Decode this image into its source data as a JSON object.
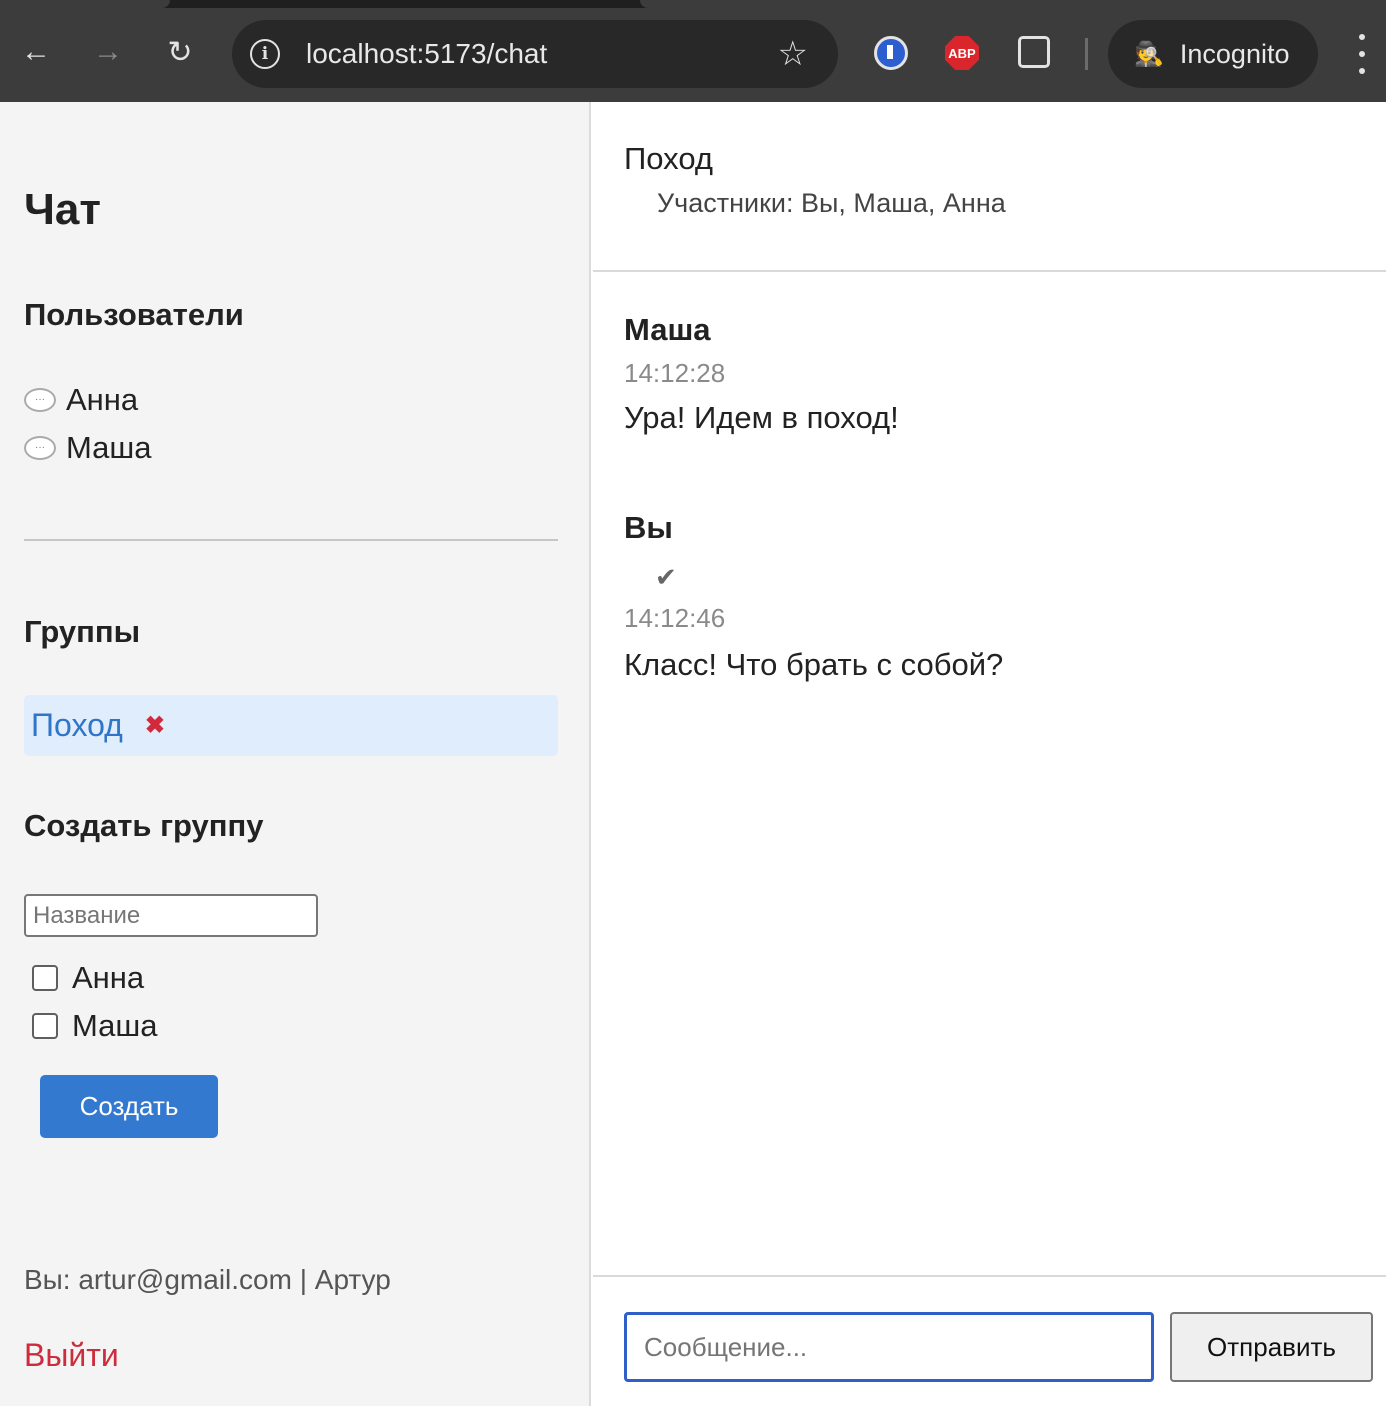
{
  "browser": {
    "url": "localhost:5173/chat",
    "incognito_label": "Incognito",
    "extensions": {
      "abp_label": "ABP"
    }
  },
  "sidebar": {
    "title": "Чат",
    "users_heading": "Пользователи",
    "users": [
      {
        "name": "Анна"
      },
      {
        "name": "Маша"
      }
    ],
    "groups_heading": "Группы",
    "groups": [
      {
        "name": "Поход",
        "delete_icon": "✖"
      }
    ],
    "create_heading": "Создать группу",
    "name_placeholder": "Название",
    "member_options": [
      {
        "name": "Анна",
        "checked": false
      },
      {
        "name": "Маша",
        "checked": false
      }
    ],
    "create_label": "Создать",
    "me": "Вы: artur@gmail.com | Артур",
    "logout_label": "Выйти"
  },
  "chat": {
    "title": "Поход",
    "members": "Участники: Вы, Маша, Анна",
    "messages": [
      {
        "author": "Маша",
        "time": "14:12:28",
        "text": "Ура! Идем в поход!"
      },
      {
        "author": "Вы",
        "status": "✔",
        "time": "14:12:46",
        "text": "Класс! Что брать с собой?"
      }
    ],
    "input_placeholder": "Сообщение...",
    "send_label": "Отправить"
  },
  "colors": {
    "accent": "#3479d0",
    "danger": "#cc2c3c",
    "group_selected_bg": "#e0edfc",
    "sidebar_bg": "#f4f4f4"
  }
}
